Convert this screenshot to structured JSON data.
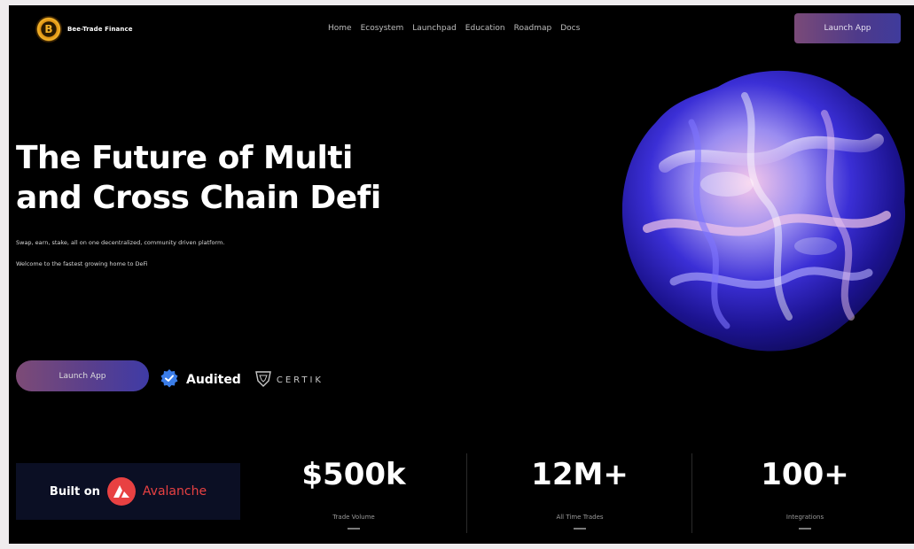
{
  "brand": {
    "name": "Bee-Trade Finance"
  },
  "nav": {
    "items": [
      "Home",
      "Ecosystem",
      "Launchpad",
      "Education",
      "Roadmap",
      "Docs"
    ]
  },
  "top_cta": "Launch App",
  "hero": {
    "headline_line1": "The Future of Multi",
    "headline_line2": "and Cross Chain Defi",
    "sub1": "Swap, earn, stake, all on one decentralized, community driven platform.",
    "sub2": "Welcome to the fastest growing home to DeFi",
    "cta": "Launch App",
    "audited": "Audited",
    "certik": "CERTIK"
  },
  "built_on": {
    "label": "Built on",
    "chain": "Avalanche"
  },
  "stats": [
    {
      "value": "$500k",
      "label": "Trade Volume"
    },
    {
      "value": "12M+",
      "label": "All Time Trades"
    },
    {
      "value": "100+",
      "label": "Integrations"
    }
  ],
  "colors": {
    "accent_purple": "#4e3a8a",
    "accent_mauve": "#7d4b76",
    "avalanche_red": "#e84142",
    "audited_blue": "#3b7de8"
  }
}
